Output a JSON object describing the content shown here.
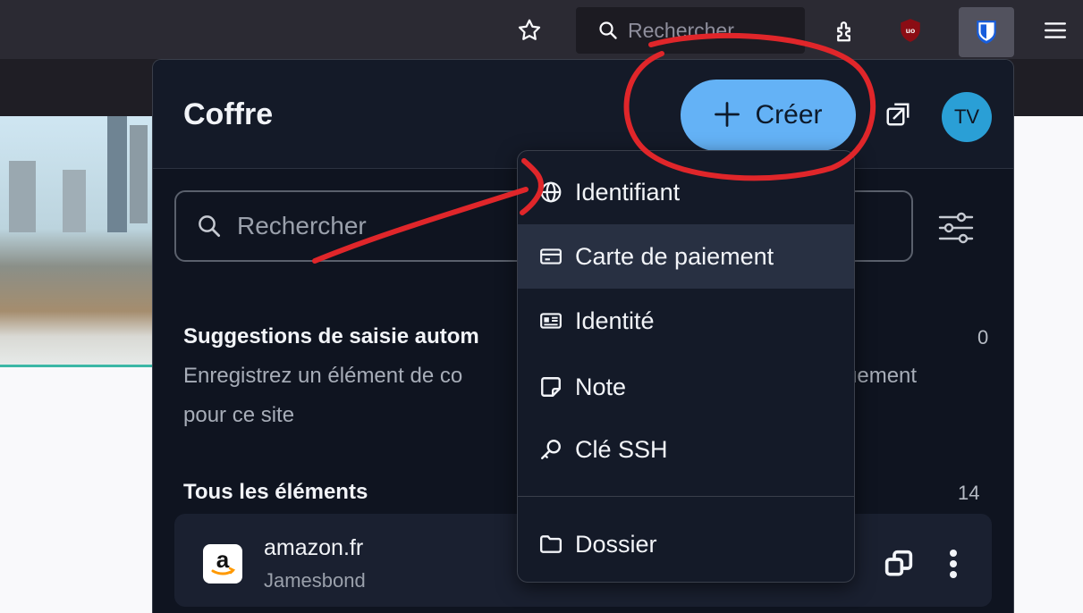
{
  "browser": {
    "search_placeholder": "Rechercher",
    "icons": [
      "star-icon",
      "search-icon",
      "extensions-icon",
      "ublock-icon",
      "bitwarden-icon",
      "hamburger-menu-icon"
    ]
  },
  "popup": {
    "title": "Coffre",
    "create_label": "Créer",
    "avatar_initials": "TV",
    "search_placeholder": "Rechercher",
    "autofill": {
      "title": "Suggestions de saisie autom",
      "count": "0",
      "desc_left": "Enregistrez un élément de co",
      "desc_right": "uement",
      "desc_line2": "pour ce site"
    },
    "all_items": {
      "title": "Tous les éléments",
      "count": "14"
    },
    "items": [
      {
        "name": "amazon.fr",
        "username": "Jamesbond",
        "logo_letter": "a"
      }
    ]
  },
  "menu": {
    "items": [
      {
        "label": "Identifiant",
        "icon": "globe-icon"
      },
      {
        "label": "Carte de paiement",
        "icon": "credit-card-icon"
      },
      {
        "label": "Identité",
        "icon": "id-card-icon"
      },
      {
        "label": "Note",
        "icon": "note-icon"
      },
      {
        "label": "Clé SSH",
        "icon": "key-icon"
      },
      {
        "label": "Dossier",
        "icon": "folder-icon"
      }
    ]
  },
  "colors": {
    "popup_bg": "#0f1420",
    "accent": "#64b2f6",
    "avatar": "#2a9fd6",
    "annotation": "#e0262a"
  }
}
